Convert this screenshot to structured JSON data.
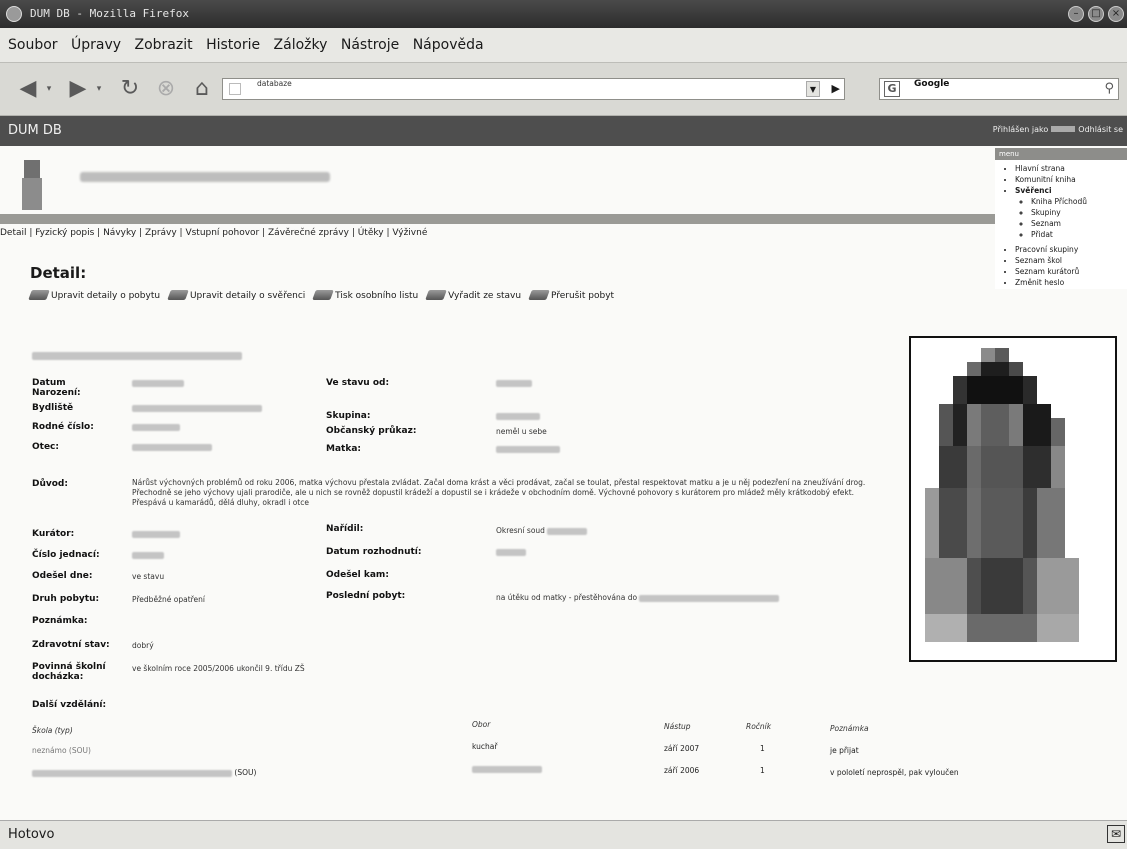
{
  "window": {
    "title": "DUM DB - Mozilla Firefox"
  },
  "menubar": [
    "Soubor",
    "Úpravy",
    "Zobrazit",
    "Historie",
    "Záložky",
    "Nástroje",
    "Nápověda"
  ],
  "nav": {
    "url": "databaze",
    "search_placeholder": "Google"
  },
  "app": {
    "name": "DUM DB",
    "logged_in_prefix": "Přihlášen jako",
    "logout": "Odhlásit se"
  },
  "subnav": "Detail | Fyzický popis | Návyky | Zprávy | Vstupní pohovor | Závěrečné zprávy | Útěky | Výživné",
  "side_menu": {
    "title": "menu",
    "items": [
      "Hlavní strana",
      "Komunitní kniha",
      "Svěřenci"
    ],
    "sub_items": [
      "Kniha Příchodů",
      "Skupiny",
      "Seznam",
      "Přidat"
    ],
    "items2": [
      "Pracovní skupiny",
      "Seznam škol",
      "Seznam kurátorů",
      "Změnit heslo"
    ]
  },
  "detail": {
    "title": "Detail:",
    "actions": [
      "Upravit detaily o pobytu",
      "Upravit detaily o svěřenci",
      "Tisk osobního listu",
      "Vyřadit ze stavu",
      "Přerušit pobyt"
    ]
  },
  "fields": {
    "datum_narozeni": "Datum Narození:",
    "ve_stavu_od": "Ve stavu od:",
    "bydliste": "Bydliště",
    "skupina": "Skupina:",
    "rodne_cislo": "Rodné číslo:",
    "obcansky": "Občanský průkaz:",
    "obcansky_val": "neměl u sebe",
    "otec": "Otec:",
    "matka": "Matka:",
    "duvod": "Důvod:",
    "duvod_val": "Nárůst výchovných problémů od roku 2006, matka výchovu přestala zvládat. Začal doma krást a věci prodávat, začal se toulat, přestal respektovat matku a je u něj podezření na zneužívání drog. Přechodně se jeho výchovy ujali prarodiče, ale u nich se rovněž dopustil krádeží a dopustil se i krádeže v obchodním domě. Výchovné pohovory s kurátorem pro mládež měly krátkodobý efekt. Přespává u kamarádů, dělá dluhy, okradl i otce",
    "kurator": "Kurátor:",
    "naridil": "Nařídil:",
    "naridil_val": "Okresní soud",
    "cislo_jednaci": "Číslo jednací:",
    "datum_rozhodnuti": "Datum rozhodnutí:",
    "odesel_dne": "Odešel dne:",
    "odesel_dne_val": "ve stavu",
    "odesel_kam": "Odešel kam:",
    "druh_pobytu": "Druh pobytu:",
    "druh_pobytu_val": "Předběžné opatření",
    "posledni_pobyt": "Poslední pobyt:",
    "posledni_pobyt_val": "na útěku od matky - přestěhována do",
    "poznamka": "Poznámka:",
    "zdravotni_stav": "Zdravotní stav:",
    "zdravotni_stav_val": "dobrý",
    "povinna": "Povinná školní docházka:",
    "povinna_val": "ve školním roce 2005/2006 ukončil 9. třídu ZŠ",
    "dalsi": "Další vzdělání:"
  },
  "education": {
    "headers": [
      "Škola (typ)",
      "Obor",
      "Nástup",
      "Ročník",
      "Poznámka"
    ],
    "rows": [
      {
        "school": "neznámo (SOU)",
        "obor": "kuchař",
        "nastup": "září 2007",
        "rocnik": "1",
        "poznamka": "je přijat"
      },
      {
        "school": "(SOU)",
        "obor": "",
        "nastup": "září 2006",
        "rocnik": "1",
        "poznamka": "v pololetí neprospěl, pak vyloučen"
      }
    ]
  },
  "status": "Hotovo"
}
